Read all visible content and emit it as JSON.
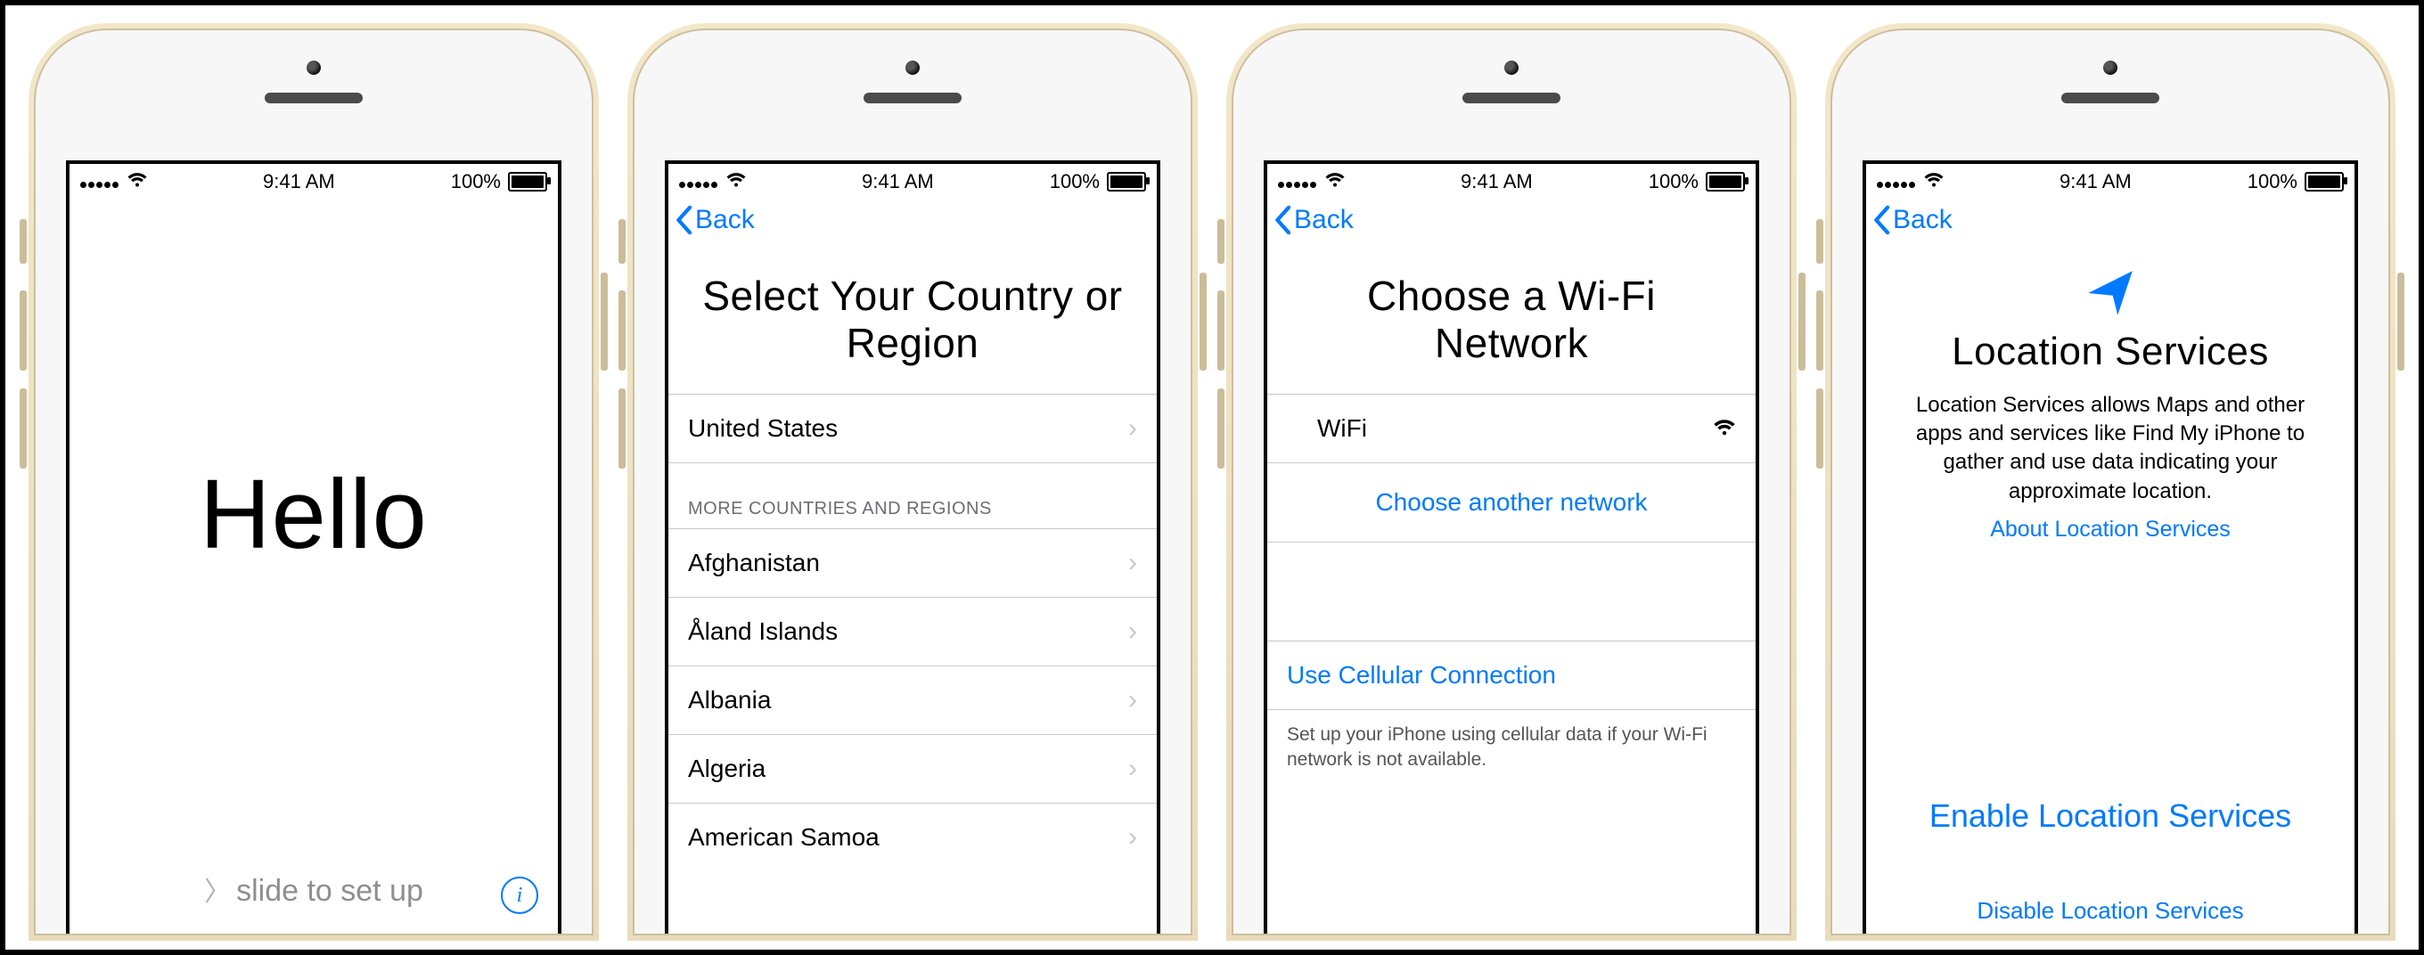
{
  "status": {
    "time": "9:41 AM",
    "battery": "100%"
  },
  "nav": {
    "back": "Back"
  },
  "screen1": {
    "hello": "Hello",
    "slide": "slide to set up"
  },
  "screen2": {
    "title": "Select Your Country or Region",
    "primary": "United States",
    "more_header": "MORE COUNTRIES AND REGIONS",
    "countries": [
      "Afghanistan",
      "Åland Islands",
      "Albania",
      "Algeria",
      "American Samoa"
    ]
  },
  "screen3": {
    "title": "Choose a Wi-Fi Network",
    "network": "WiFi",
    "choose_another": "Choose another network",
    "use_cellular": "Use Cellular Connection",
    "cellular_footnote": "Set up your iPhone using cellular data if your Wi-Fi network is not available."
  },
  "screen4": {
    "title": "Location Services",
    "body": "Location Services allows Maps and other apps and services like Find My iPhone to gather and use data indicating your approximate location.",
    "about": "About Location Services",
    "enable": "Enable Location Services",
    "disable": "Disable Location Services"
  }
}
